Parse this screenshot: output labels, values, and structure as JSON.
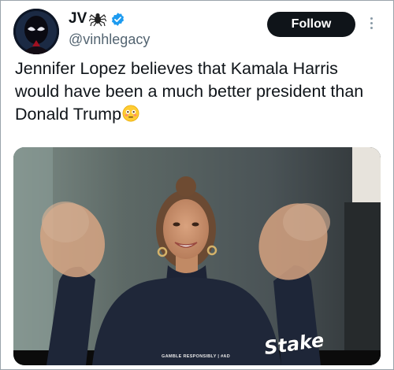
{
  "tweet": {
    "display_name": "JV",
    "handle": "@vinhlegacy",
    "follow_label": "Follow",
    "text": "Jennifer Lopez believes that Kamala Harris would have been a much better president than Donald Trump"
  },
  "icons": {
    "spider": "spider-emoji-icon",
    "verified": "verified-badge-icon",
    "emoji": "flushed-face-emoji-icon",
    "more": "more-vertical-icon"
  },
  "media": {
    "disclaimer": "GAMBLE RESPONSIBLY | #AD",
    "sponsor_logo": "Stake"
  },
  "colors": {
    "follow_bg": "#0f1419",
    "verified": "#1d9bf0",
    "handle": "#536471"
  }
}
